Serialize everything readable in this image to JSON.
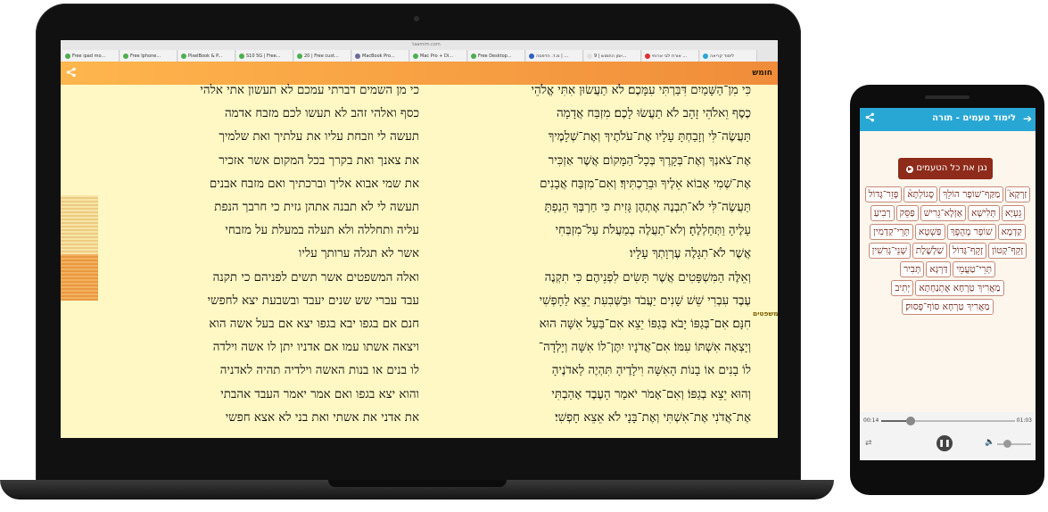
{
  "laptop": {
    "url": "taamim.com",
    "tabs": [
      {
        "label": "Free ipad mo...",
        "color": "#4caf50"
      },
      {
        "label": "Free Iphone...",
        "color": "#4caf50"
      },
      {
        "label": "PixelBook & P...",
        "color": "#4caf50"
      },
      {
        "label": "S10 5G | Free...",
        "color": "#4caf50"
      },
      {
        "label": "20 | Free cust...",
        "color": "#4caf50"
      },
      {
        "label": "MacBook Pro...",
        "color": "#6b6b9a"
      },
      {
        "label": "Mac Pro + Di...",
        "color": "#4caf50"
      },
      {
        "label": "Free Desktop...",
        "color": "#4caf50"
      },
      {
        "label": "מ.ד. הדפסה | ...",
        "color": "#3060c0"
      },
      {
        "label": "יומן החמוש | 9...",
        "color": "#e0e0e0"
      },
      {
        "label": "אורח לבי ארוחי ...",
        "color": "#e03030"
      },
      {
        "label": "לימוד קריאה",
        "color": "#29a7d4"
      }
    ],
    "app": {
      "brand": "חומש",
      "share_icon": "share-icon"
    },
    "side_label": "משפטים",
    "plain_text": [
      "כי מן השמים דברתי עמכם לא תעשון אתי אלהי",
      "כסף ואלהי זהב לא תעשו לכם מזבח אדמה",
      "תעשה לי וזבחת עליו את עלתיך ואת שלמיך",
      "את צאנך ואת בקרך בכל המקום אשר אזכיר",
      "את שמי אבוא אליך וברכתיך ואם מזבח אבנים",
      "תעשה לי לא תבנה אתהן גזית כי חרבך הנפת",
      "עליה ותחללה ולא תעלה במעלת על מזבחי",
      "אשר לא תגלה ערותך עליו",
      "ואלה המשפטים אשר תשים לפניהם כי תקנה",
      "עבד עברי שש שנים יעבד ובשבעת יצא לחפשי",
      "חנם אם בגפו יבא בגפו יצא אם בעל אשה הוא",
      "ויצאה אשתו עמו אם אדניו יתן לו אשה וילדה",
      "לו בנים או בנות האשה וילדיה תהיה לאדניה",
      "והוא יצא בגפו ואם אמר יאמר העבד אהבתי",
      "את אדני את אשתי ואת בני לא אצא חפשי"
    ],
    "vocalized_text": [
      "כִּי מִן־הַשָּׁמַיִם דִּבַּרְתִּי עִמָּכֶם׃ לֹא תַעֲשׂוּן אִתִּי אֱלֹהֵי",
      "כֶסֶף וֵאלֹהֵי זָהָב לֹא תַעֲשׂוּ לָכֶם׃ מִזְבַּח אֲדָמָה",
      "תַּעֲשֶׂה־לִּי וְזָבַחְתָּ עָלָיו אֶת־עֹלֹתֶיךָ וְאֶת־שְׁלָמֶיךָ",
      "אֶת־צֹאנְךָ וְאֶת־בְּקָרֶךָ בְּכָל־הַמָּקוֹם אֲשֶׁר אַזְכִּיר",
      "אֶת־שְׁמִי אָבוֹא אֵלֶיךָ וּבֵרַכְתִּיךָ׃ וְאִם־מִזְבַּח אֲבָנִים",
      "תַּעֲשֶׂה־לִּי לֹא־תִבְנֶה אֶתְהֶן גָּזִית כִּי חַרְבְּךָ הֵנַפְתָּ",
      "עָלֶיהָ וַתְּחַלְלֶהָ׃ וְלֹא־תַעֲלֶה בְמַעֲלֹת עַל־מִזְבְּחִי",
      "אֲשֶׁר לֹא־תִגָּלֶה עֶרְוָתְךָ עָלָיו׃",
      "וְאֵלֶּה הַמִּשְׁפָּטִים אֲשֶׁר תָּשִׂים לִפְנֵיהֶם׃ כִּי תִקְנֶה",
      "עֶבֶד עִבְרִי שֵׁשׁ שָׁנִים יַעֲבֹד וּבַשְּׁבִעִת יֵצֵא לַחָפְשִׁי",
      "חִנָּם׃ אִם־בְּגַפּוֹ יָבֹא בְּגַפּוֹ יֵצֵא אִם־בַּעַל אִשָּׁה הוּא",
      "וְיָצְאָה אִשְׁתּוֹ עִמּוֹ׃ אִם־אֲדֹנָיו יִתֶּן־לוֹ אִשָּׁה וְיָלְדָה־",
      "לוֹ בָנִים אוֹ בָנוֹת הָאִשָּׁה וִילָדֶיהָ תִּהְיֶה לַאדֹנֶיהָ",
      "וְהוּא יֵצֵא בְגַפּוֹ׃ וְאִם־אָמֹר יֹאמַר הָעֶבֶד אָהַבְתִּי",
      "אֶת־אֲדֹנִי אֶת־אִשְׁתִּי וְאֶת־בָּנָי לֹא אֵצֵא חָפְשִׁי׃"
    ]
  },
  "phone": {
    "title": "לימוד טעמים - תורה",
    "back_icon": "arrow-right-icon",
    "share_icon": "share-icon",
    "play_all_label": "נגן את כל הטעמים",
    "taamim": [
      "זַרְקָא֮",
      "מַקַּף־שׁוֹפָר הוֹלֵךְ",
      "סֶגוֹלְתָּא֒",
      "פָּזֵר־גָּדוֹל",
      "גֵּעְיָא",
      "תְּלִישָׁא",
      "אַזְלָא־גֵּרִישׁ",
      "פַּסֵּק",
      "רְבִיעַ",
      "קַדְמָא",
      "שׁוֹפָר מְהֻפָּךְ",
      "פַּשְׁטָא",
      "תְּרֵי־קַדְמִין",
      "זָקֵף־קָטוֹן",
      "זָקֵף־גָּדוֹל",
      "שַׁלְשֶׁלֶת",
      "שְׁנֵי־גְרִשִׁין",
      "תְּרֵי־טַעֲמֵי",
      "דַּרְגָּא",
      "תְּבִיר",
      "מַאֲרִיךְ טַרְחָא אֶתְנַחְתָּא",
      "יְתִיב",
      "מַאֲרִיךְ טַרְחָא סוֹף־פָּסוּק׃"
    ],
    "player": {
      "time_elapsed": "00:14",
      "time_total": "01:03",
      "progress_fraction": 0.22,
      "volume_fraction": 0.3
    }
  }
}
